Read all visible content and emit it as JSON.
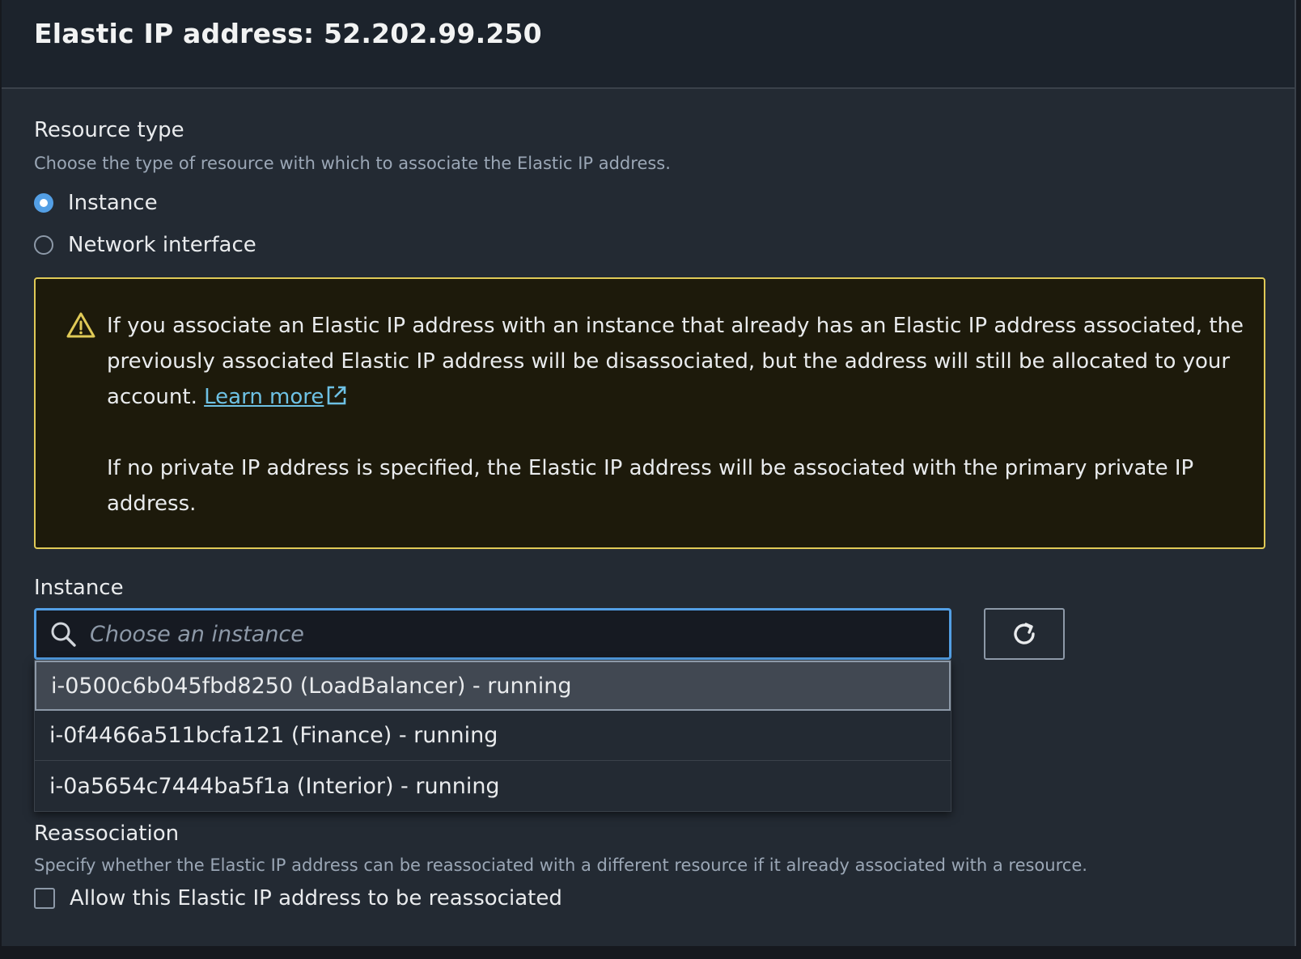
{
  "modal": {
    "title": "Elastic IP address: 52.202.99.250"
  },
  "resource_type": {
    "label": "Resource type",
    "description": "Choose the type of resource with which to associate the Elastic IP address.",
    "options": [
      {
        "label": "Instance",
        "selected": true
      },
      {
        "label": "Network interface",
        "selected": false
      }
    ]
  },
  "alert": {
    "type": "warning",
    "paragraph1": "If you associate an Elastic IP address with an instance that already has an Elastic IP address associated, the previously associated Elastic IP address will be disassociated, but the address will still be allocated to your account.",
    "link_label": "Learn more",
    "paragraph2": "If no private IP address is specified, the Elastic IP address will be associated with the primary private IP address."
  },
  "instance": {
    "label": "Instance",
    "placeholder": "Choose an instance",
    "value": "",
    "options": [
      "i-0500c6b045fbd8250 (LoadBalancer) - running",
      "i-0f4466a511bcfa121 (Finance) - running",
      "i-0a5654c7444ba5f1a (Interior) - running"
    ],
    "highlighted_index": 0
  },
  "reassociation": {
    "label": "Reassociation",
    "description": "Specify whether the Elastic IP address can be reassociated with a different resource if it already associated with a resource.",
    "checkbox_label": "Allow this Elastic IP address to be reassociated",
    "checked": false
  },
  "colors": {
    "accent": "#539fe5",
    "warning_border": "#e0ca57",
    "warning_bg": "#1d1a0b",
    "link": "#6ec1e4",
    "panel_bg": "#232a33"
  },
  "icons": {
    "warning": "warning-triangle-icon",
    "external_link": "external-link-icon",
    "search": "search-icon",
    "refresh": "refresh-icon"
  }
}
